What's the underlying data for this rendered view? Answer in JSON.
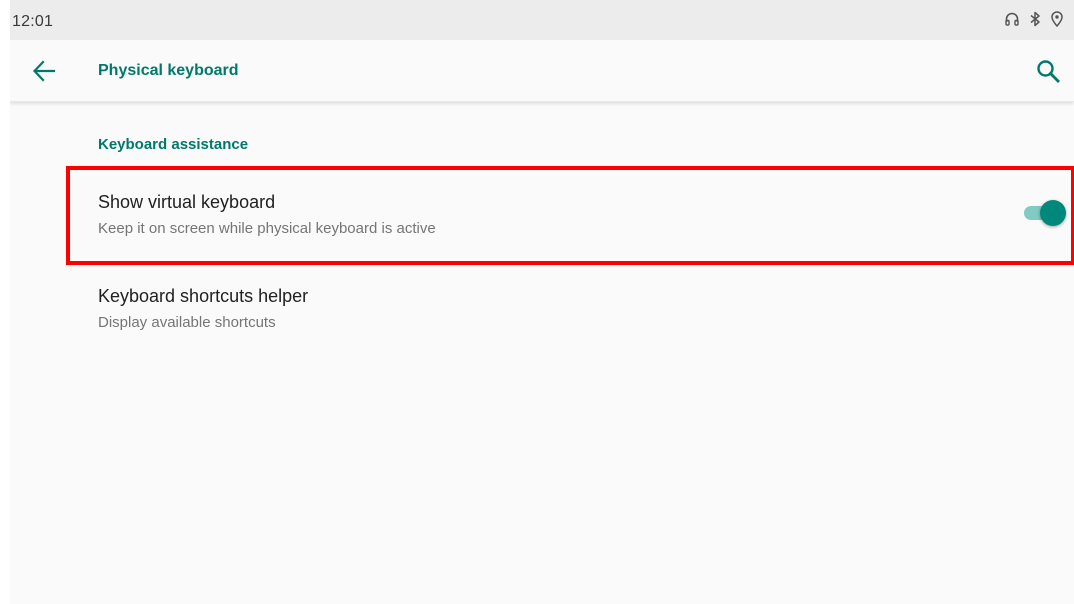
{
  "status_bar": {
    "time": "12:01",
    "icons": [
      "headphones-icon",
      "bluetooth-icon",
      "location-icon"
    ]
  },
  "app_bar": {
    "title": "Physical keyboard",
    "back_icon": "arrow-left-icon",
    "search_icon": "search-icon"
  },
  "colors": {
    "accent": "#00796b",
    "toggle_on_thumb": "#00897b",
    "toggle_on_track": "#80cbc4",
    "highlight": "#ff0000"
  },
  "section": {
    "header": "Keyboard assistance"
  },
  "preferences": [
    {
      "title": "Show virtual keyboard",
      "summary": "Keep it on screen while physical keyboard is active",
      "toggle_on": true
    },
    {
      "title": "Keyboard shortcuts helper",
      "summary": "Display available shortcuts"
    }
  ]
}
